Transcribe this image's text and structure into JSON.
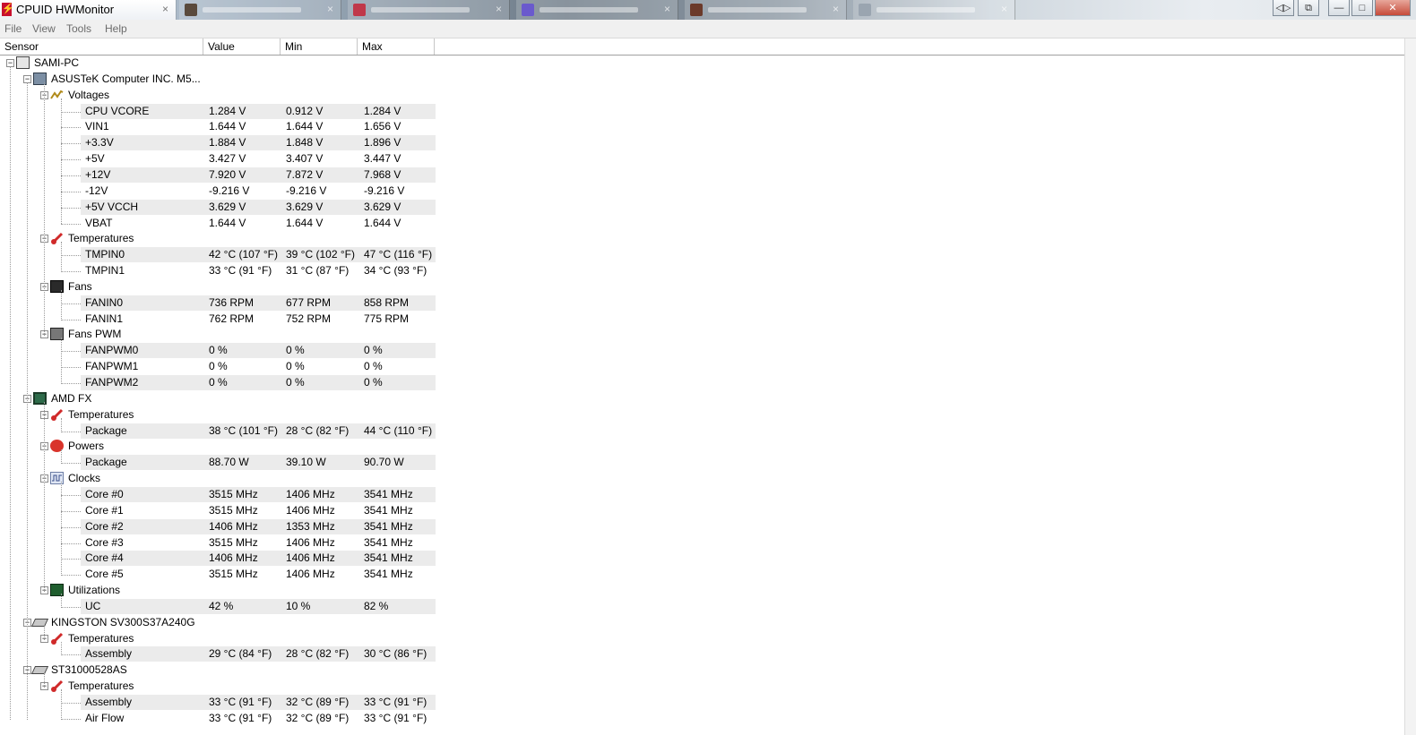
{
  "window": {
    "title": "CPUID HWMonitor",
    "close_glyph": "×",
    "app_icon_glyph": "⚡",
    "background_tabs": [
      {
        "favicon_color": "#5a4a3c"
      },
      {
        "favicon_color": "#c0384a"
      },
      {
        "favicon_color": "#6a5acd"
      },
      {
        "favicon_color": "#6b3a2a"
      },
      {
        "favicon_color": "#9aa5b0"
      }
    ],
    "controls": {
      "nav": "◁▷",
      "restore_pin": "⧉",
      "minimize": "—",
      "maximize": "□",
      "close": "✕"
    }
  },
  "menu": [
    "File",
    "View",
    "Tools",
    "Help"
  ],
  "columns": {
    "sensor": "Sensor",
    "value": "Value",
    "min": "Min",
    "max": "Max"
  },
  "tree": [
    {
      "level": 0,
      "icon": "computer-icon",
      "label": "SAMI-PC",
      "expand": "−"
    },
    {
      "level": 1,
      "icon": "motherboard-icon",
      "label": "ASUSTeK Computer INC. M5...",
      "expand": "−"
    },
    {
      "level": 2,
      "icon": "voltage-icon",
      "label": "Voltages",
      "expand": "−"
    },
    {
      "level": 3,
      "label": "CPU VCORE",
      "value": "1.284 V",
      "min": "0.912 V",
      "max": "1.284 V"
    },
    {
      "level": 3,
      "label": "VIN1",
      "value": "1.644 V",
      "min": "1.644 V",
      "max": "1.656 V"
    },
    {
      "level": 3,
      "label": "+3.3V",
      "value": "1.884 V",
      "min": "1.848 V",
      "max": "1.896 V"
    },
    {
      "level": 3,
      "label": "+5V",
      "value": "3.427 V",
      "min": "3.407 V",
      "max": "3.447 V"
    },
    {
      "level": 3,
      "label": "+12V",
      "value": "7.920 V",
      "min": "7.872 V",
      "max": "7.968 V"
    },
    {
      "level": 3,
      "label": "-12V",
      "value": "-9.216 V",
      "min": "-9.216 V",
      "max": "-9.216 V"
    },
    {
      "level": 3,
      "label": "+5V VCCH",
      "value": "3.629 V",
      "min": "3.629 V",
      "max": "3.629 V"
    },
    {
      "level": 3,
      "label": "VBAT",
      "value": "1.644 V",
      "min": "1.644 V",
      "max": "1.644 V"
    },
    {
      "level": 2,
      "icon": "thermometer-icon",
      "label": "Temperatures",
      "expand": "−"
    },
    {
      "level": 3,
      "label": "TMPIN0",
      "value": "42 °C  (107 °F)",
      "min": "39 °C  (102 °F)",
      "max": "47 °C  (116 °F)"
    },
    {
      "level": 3,
      "label": "TMPIN1",
      "value": "33 °C  (91 °F)",
      "min": "31 °C  (87 °F)",
      "max": "34 °C  (93 °F)"
    },
    {
      "level": 2,
      "icon": "fan-icon",
      "label": "Fans",
      "expand": "−"
    },
    {
      "level": 3,
      "label": "FANIN0",
      "value": "736 RPM",
      "min": "677 RPM",
      "max": "858 RPM"
    },
    {
      "level": 3,
      "label": "FANIN1",
      "value": "762 RPM",
      "min": "752 RPM",
      "max": "775 RPM"
    },
    {
      "level": 2,
      "icon": "fan-pwm-icon",
      "label": "Fans PWM",
      "expand": "−"
    },
    {
      "level": 3,
      "label": "FANPWM0",
      "value": "0 %",
      "min": "0 %",
      "max": "0 %"
    },
    {
      "level": 3,
      "label": "FANPWM1",
      "value": "0 %",
      "min": "0 %",
      "max": "0 %"
    },
    {
      "level": 3,
      "label": "FANPWM2",
      "value": "0 %",
      "min": "0 %",
      "max": "0 %"
    },
    {
      "level": 1,
      "icon": "cpu-chip-icon",
      "label": "AMD FX",
      "expand": "−"
    },
    {
      "level": 2,
      "icon": "thermometer-icon",
      "label": "Temperatures",
      "expand": "−"
    },
    {
      "level": 3,
      "label": "Package",
      "value": "38 °C  (101 °F)",
      "min": "28 °C  (82 °F)",
      "max": "44 °C  (110 °F)"
    },
    {
      "level": 2,
      "icon": "power-icon",
      "label": "Powers",
      "expand": "−"
    },
    {
      "level": 3,
      "label": "Package",
      "value": "88.70 W",
      "min": "39.10 W",
      "max": "90.70 W"
    },
    {
      "level": 2,
      "icon": "clock-icon",
      "label": "Clocks",
      "expand": "−"
    },
    {
      "level": 3,
      "label": "Core #0",
      "value": "3515 MHz",
      "min": "1406 MHz",
      "max": "3541 MHz"
    },
    {
      "level": 3,
      "label": "Core #1",
      "value": "3515 MHz",
      "min": "1406 MHz",
      "max": "3541 MHz"
    },
    {
      "level": 3,
      "label": "Core #2",
      "value": "1406 MHz",
      "min": "1353 MHz",
      "max": "3541 MHz"
    },
    {
      "level": 3,
      "label": "Core #3",
      "value": "3515 MHz",
      "min": "1406 MHz",
      "max": "3541 MHz"
    },
    {
      "level": 3,
      "label": "Core #4",
      "value": "1406 MHz",
      "min": "1406 MHz",
      "max": "3541 MHz"
    },
    {
      "level": 3,
      "label": "Core #5",
      "value": "3515 MHz",
      "min": "1406 MHz",
      "max": "3541 MHz"
    },
    {
      "level": 2,
      "icon": "utilization-icon",
      "label": "Utilizations",
      "expand": "−"
    },
    {
      "level": 3,
      "label": "UC",
      "value": "42 %",
      "min": "10 %",
      "max": "82 %"
    },
    {
      "level": 1,
      "icon": "disk-icon",
      "label": "KINGSTON SV300S37A240G",
      "expand": "−"
    },
    {
      "level": 2,
      "icon": "thermometer-icon",
      "label": "Temperatures",
      "expand": "−"
    },
    {
      "level": 3,
      "label": "Assembly",
      "value": "29 °C  (84 °F)",
      "min": "28 °C  (82 °F)",
      "max": "30 °C  (86 °F)"
    },
    {
      "level": 1,
      "icon": "disk-icon",
      "label": "ST31000528AS",
      "expand": "−"
    },
    {
      "level": 2,
      "icon": "thermometer-icon",
      "label": "Temperatures",
      "expand": "−"
    },
    {
      "level": 3,
      "label": "Assembly",
      "value": "33 °C  (91 °F)",
      "min": "32 °C  (89 °F)",
      "max": "33 °C  (91 °F)"
    },
    {
      "level": 3,
      "label": "Air Flow",
      "value": "33 °C  (91 °F)",
      "min": "32 °C  (89 °F)",
      "max": "33 °C  (91 °F)"
    }
  ]
}
